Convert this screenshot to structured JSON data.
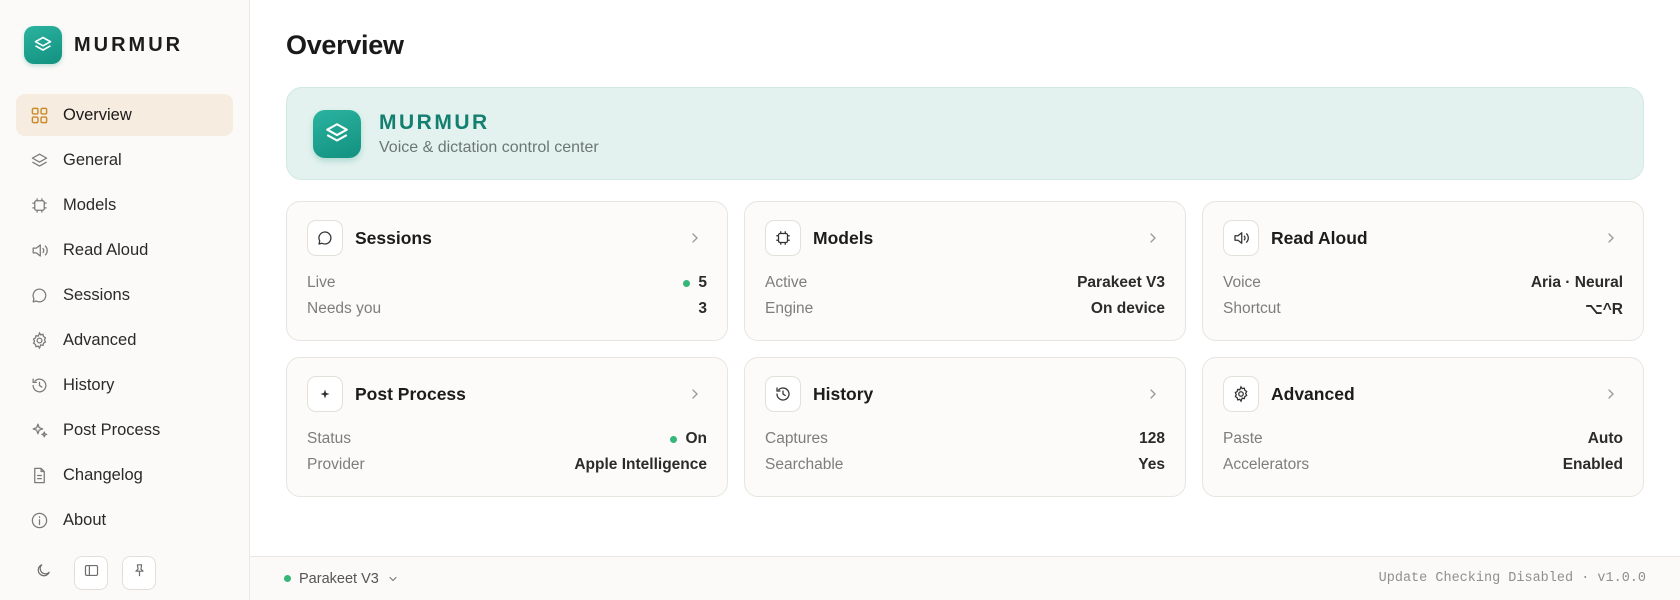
{
  "brand": {
    "name": "MURMUR"
  },
  "sidebar": {
    "items": [
      {
        "label": "Overview",
        "icon": "grid-icon",
        "active": true
      },
      {
        "label": "General",
        "icon": "layers-icon"
      },
      {
        "label": "Models",
        "icon": "chip-icon"
      },
      {
        "label": "Read Aloud",
        "icon": "speaker-icon"
      },
      {
        "label": "Sessions",
        "icon": "chat-bubble-icon"
      },
      {
        "label": "Advanced",
        "icon": "gear-icon"
      },
      {
        "label": "History",
        "icon": "history-icon"
      },
      {
        "label": "Post Process",
        "icon": "sparkle-icon"
      },
      {
        "label": "Changelog",
        "icon": "document-icon"
      },
      {
        "label": "About",
        "icon": "info-icon"
      }
    ],
    "footer": {
      "theme_icon": "moon-icon",
      "sidebar_toggle_icon": "sidebar-panel-icon",
      "pin_icon": "pin-icon"
    }
  },
  "main": {
    "title": "Overview",
    "hero": {
      "title": "MURMUR",
      "subtitle": "Voice & dictation control center"
    },
    "cards": [
      {
        "title": "Sessions",
        "icon": "chat-bubble-icon",
        "rows": [
          {
            "key": "Live",
            "value": "5",
            "dot": true
          },
          {
            "key": "Needs you",
            "value": "3"
          }
        ]
      },
      {
        "title": "Models",
        "icon": "chip-icon",
        "rows": [
          {
            "key": "Active",
            "value": "Parakeet V3"
          },
          {
            "key": "Engine",
            "value": "On device"
          }
        ]
      },
      {
        "title": "Read Aloud",
        "icon": "speaker-icon",
        "rows": [
          {
            "key": "Voice",
            "value": "Aria · Neural"
          },
          {
            "key": "Shortcut",
            "value": "⌥^R"
          }
        ]
      },
      {
        "title": "Post Process",
        "icon": "sparkle-icon",
        "rows": [
          {
            "key": "Status",
            "value": "On",
            "dot": true
          },
          {
            "key": "Provider",
            "value": "Apple Intelligence"
          }
        ]
      },
      {
        "title": "History",
        "icon": "history-icon",
        "rows": [
          {
            "key": "Captures",
            "value": "128"
          },
          {
            "key": "Searchable",
            "value": "Yes"
          }
        ]
      },
      {
        "title": "Advanced",
        "icon": "gear-icon",
        "rows": [
          {
            "key": "Paste",
            "value": "Auto"
          },
          {
            "key": "Accelerators",
            "value": "Enabled"
          }
        ]
      }
    ]
  },
  "statusbar": {
    "model": "Parakeet V3",
    "version_text": "Update Checking Disabled · v1.0.0"
  },
  "colors": {
    "accent": "#12917f",
    "active_nav_bg": "#f6ecdf",
    "active_nav_icon": "#c98a2b",
    "status_dot": "#35b779",
    "hero_bg": "#e3f2ee"
  }
}
